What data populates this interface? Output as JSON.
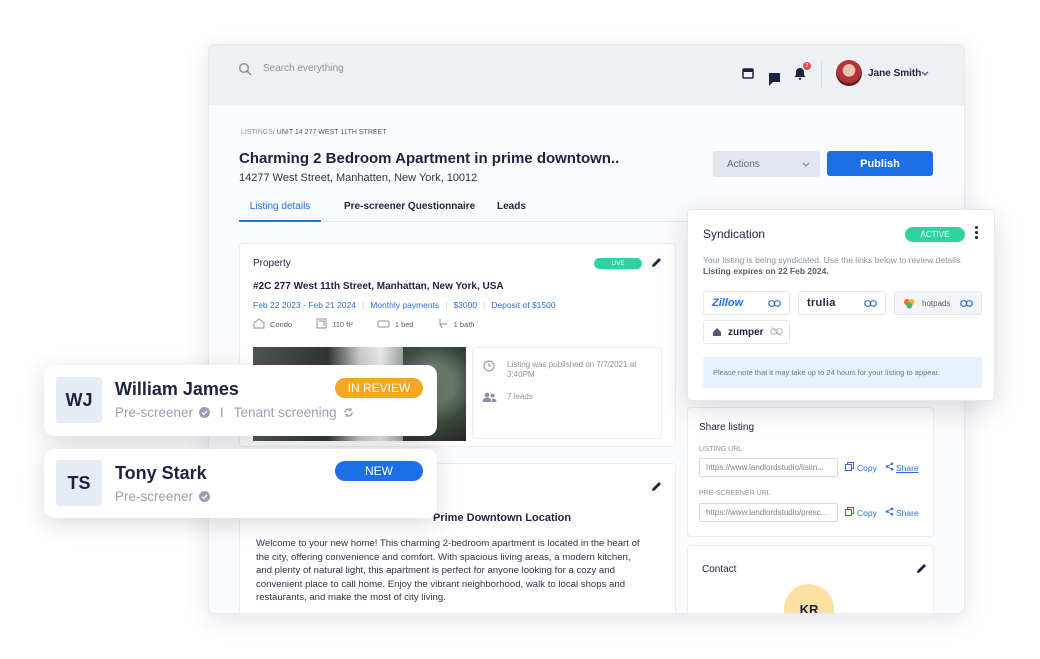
{
  "topbar": {
    "search_placeholder": "Search everything",
    "notification_count": "2",
    "user_name": "Jane Smith"
  },
  "page": {
    "breadcrumb_root": "LISTINGS/",
    "breadcrumb_current": "UNIT 14 277 WEST 11TH STREET",
    "title": "Charming 2 Bedroom Apartment in prime downtown..",
    "subtitle": "14277 West Street, Manhatten, New York, 10012",
    "actions_label": "Actions",
    "publish_label": "Publish",
    "tabs": [
      "Listing details",
      "Pre-screener Questionnaire",
      "Leads"
    ]
  },
  "property": {
    "header": "Property",
    "status": "LIVE",
    "address": "#2C 277 West 11th Street, Manhattan, New York, USA",
    "dates": "Feb 22 2023 - Feb 21 2024",
    "payments": "Monthly payments",
    "rent": "$3000",
    "deposit": "Deposit of $1500",
    "type": "Condo",
    "area": "110 ft²",
    "beds": "1 bed",
    "baths": "1 bath",
    "published": "Listing was published on 7/7/2021 at 3:40PM",
    "leads": "7 leads"
  },
  "description": {
    "heading": "Prime Downtown Location",
    "body": "Welcome to your new home! This charming 2-bedroom apartment is located in the heart of the city, offering convenience and comfort. With spacious living areas, a modern kitchen, and plenty of natural light, this apartment is perfect for anyone looking for a cozy and convenient place to call home. Enjoy the vibrant neighborhood, walk to local shops and restaurants, and make the most of city living."
  },
  "syndication": {
    "title": "Syndication",
    "status": "ACTIVE",
    "desc": "Your listing is being syndicated. Use the links below to review details.",
    "desc_bold": "Listing expires on 22 Feb 2024.",
    "portals": [
      "Zillow",
      "trulia",
      "hotpads",
      "zumper"
    ],
    "note": "Please note that it may take up to 24 hours for your listing to appear."
  },
  "share": {
    "title": "Share listing",
    "listing_url_label": "LISTING URL",
    "listing_url": "https://www.landlordstudio/listin...",
    "prescreener_url_label": "PRE-SCREENER URL",
    "prescreener_url": "https://www.landlordstudio/presc...",
    "copy_label": "Copy",
    "share_label": "Share"
  },
  "contact": {
    "title": "Contact",
    "initials": "KR"
  },
  "applicants": [
    {
      "initials": "WJ",
      "name": "William James",
      "status": "IN REVIEW",
      "step1": "Pre-screener",
      "sep": "I",
      "step2": "Tenant screening"
    },
    {
      "initials": "TS",
      "name": "Tony Stark",
      "status": "NEW",
      "step1": "Pre-screener"
    }
  ],
  "colors": {
    "primary": "#1e6ee6",
    "live": "#2fd3a0",
    "active": "#2fd3a0",
    "in_review": "#f5a623",
    "new": "#1e6ee6",
    "navy": "#1c2340"
  }
}
